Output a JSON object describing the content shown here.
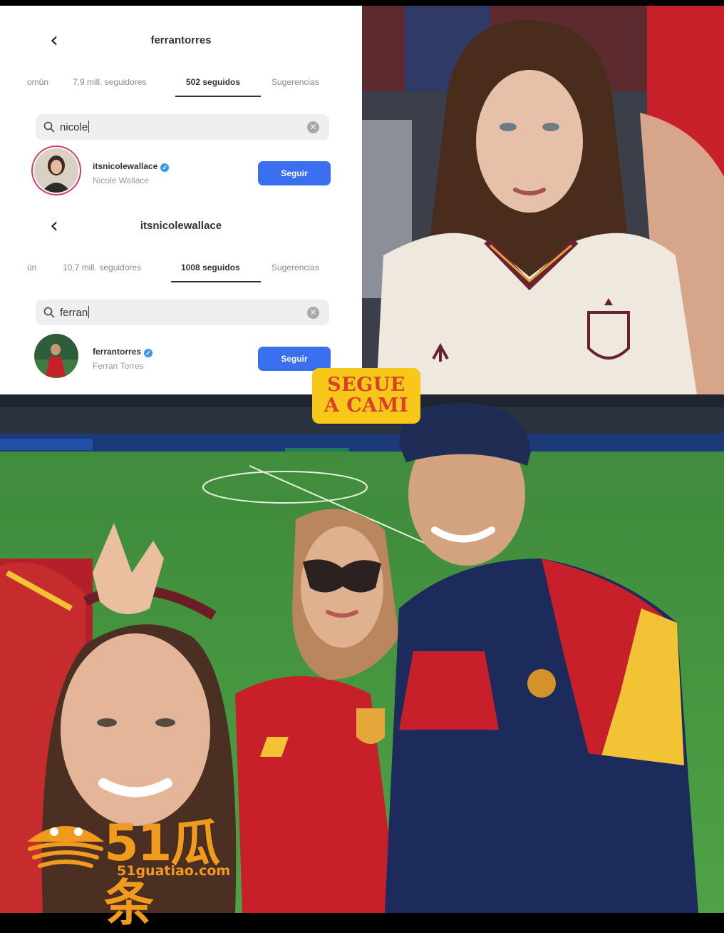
{
  "panels": [
    {
      "title": "ferrantorres",
      "tabs": [
        "omún",
        "7,9 mill. seguidores",
        "502 seguidos",
        "Sugerencias"
      ],
      "search_value": "nicole",
      "result": {
        "username": "itsnicolewallace",
        "name": "Nicole Wallace",
        "button": "Seguir"
      }
    },
    {
      "title": "itsnicolewallace",
      "tabs": [
        "ún",
        "10,7 mill. seguidores",
        "1008 seguidos",
        "Sugerencias"
      ],
      "search_value": "ferran",
      "result": {
        "username": "ferrantorres",
        "name": "Ferran Torres",
        "button": "Seguir"
      }
    }
  ],
  "badge": {
    "line1": "SEGUE",
    "line2": "A CAMI"
  },
  "watermark": {
    "brand": "51瓜条",
    "url": "51guatiao.com"
  },
  "colors": {
    "accent": "#3a6ff0",
    "badge": "#f7c81a",
    "badge_text": "#d9412e",
    "watermark": "#f09a1e"
  }
}
